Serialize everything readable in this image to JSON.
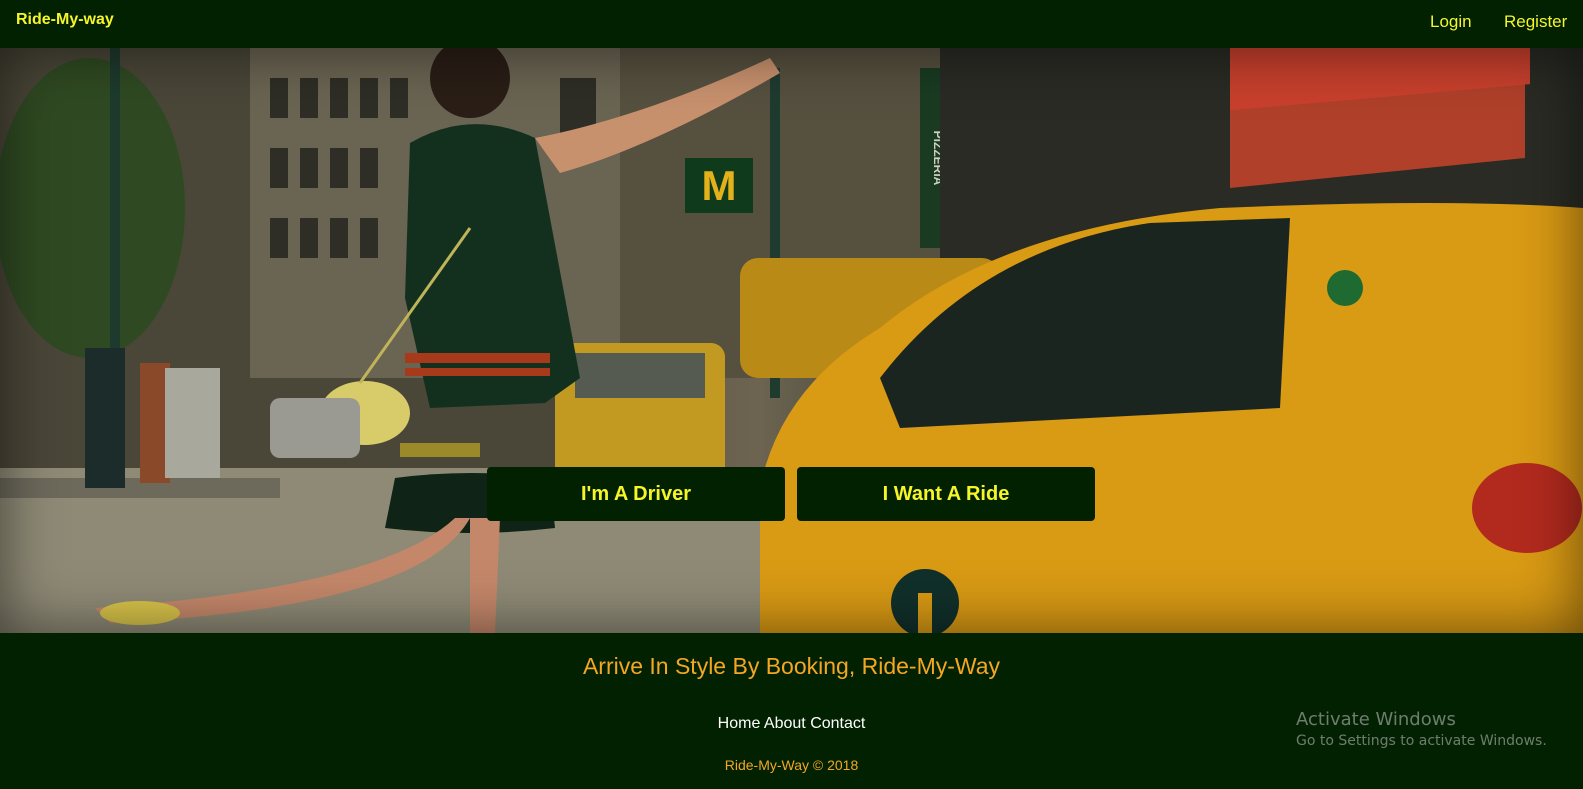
{
  "navbar": {
    "brand": "Ride-My-way",
    "links": [
      "Login",
      "Register"
    ]
  },
  "hero": {
    "image": "city-street-taxi-photo",
    "buttons": [
      "I'm A Driver",
      "I Want A Ride"
    ],
    "sign_text": "PIZZERIA"
  },
  "footer": {
    "tagline": "Arrive In Style By Booking, Ride-My-Way",
    "links": [
      "Home",
      "About",
      "Contact"
    ],
    "copyright": "Ride-My-Way © 2018"
  },
  "watermark": {
    "title": "Activate Windows",
    "subtitle": "Go to Settings to activate Windows."
  },
  "colors": {
    "bar_background": "#012100",
    "accent_yellow": "#f5f52a",
    "accent_orange": "#f5a623",
    "taxi_yellow": "#e0a417"
  }
}
